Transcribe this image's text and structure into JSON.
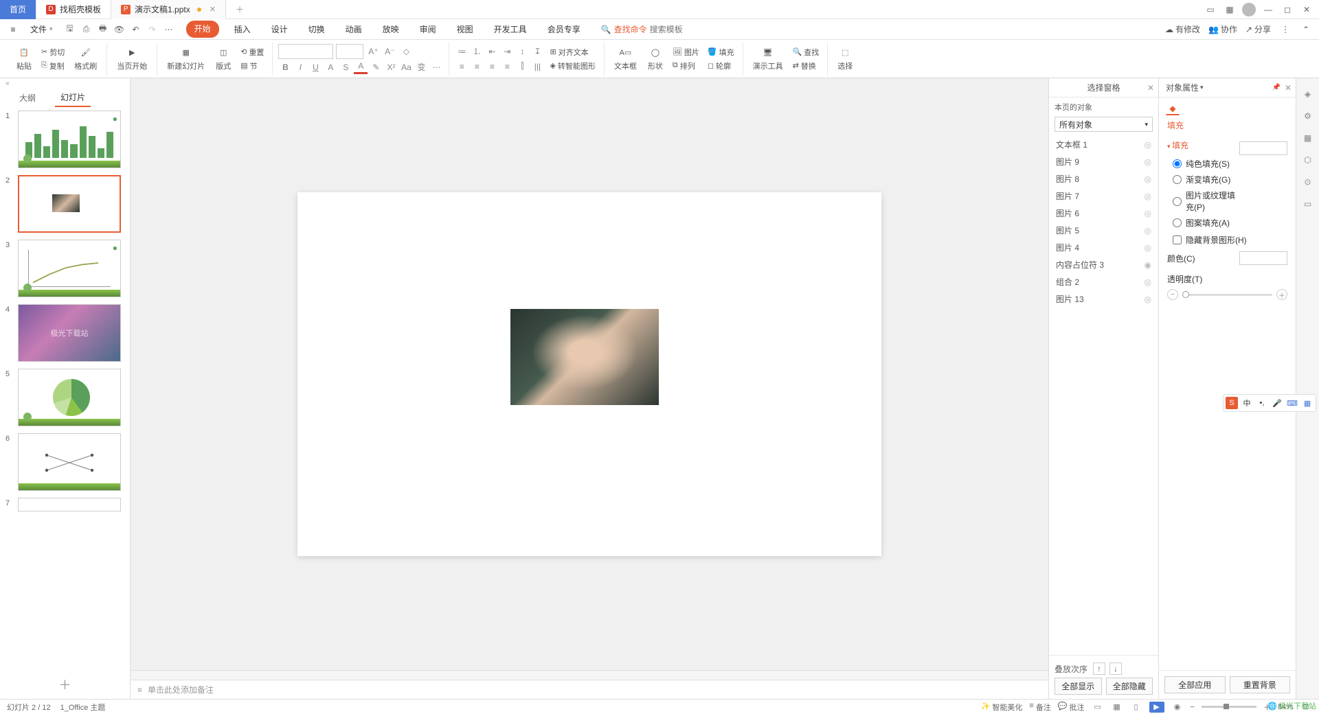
{
  "titlebar": {
    "home": "首页",
    "tab1": "找稻壳模板",
    "tab2": "演示文稿1.pptx"
  },
  "menubar": {
    "file": "文件",
    "tabs": [
      "开始",
      "插入",
      "设计",
      "切换",
      "动画",
      "放映",
      "审阅",
      "视图",
      "开发工具",
      "会员专享"
    ],
    "search_label": "查找命令",
    "search_placeholder": "搜索模板",
    "pending": "有修改",
    "collab": "协作",
    "share": "分享"
  },
  "ribbon": {
    "paste": "粘贴",
    "cut": "剪切",
    "copy": "复制",
    "format_painter": "格式刷",
    "from_begin": "当页开始",
    "new_slide": "新建幻灯片",
    "layout": "版式",
    "reset": "重置",
    "section": "节",
    "align_text": "对齐文本",
    "convert_smart": "转智能图形",
    "textbox": "文本框",
    "shape": "形状",
    "picture": "图片",
    "fill": "填充",
    "arrange": "排列",
    "outline": "轮廓",
    "presenter": "演示工具",
    "find": "查找",
    "replace": "替换",
    "select": "选择"
  },
  "slidepanel": {
    "outline": "大纲",
    "slides": "幻灯片",
    "thumb4_text": "极光下载站"
  },
  "notes": {
    "placeholder": "单击此处添加备注"
  },
  "selection_pane": {
    "title": "选择窗格",
    "subtitle": "本页的对象",
    "all_objects": "所有对象",
    "items": [
      "文本框 1",
      "图片 9",
      "图片 8",
      "图片 7",
      "图片 6",
      "图片 5",
      "图片 4",
      "内容占位符 3",
      "组合 2",
      "图片 13"
    ],
    "order": "叠放次序",
    "show_all": "全部显示",
    "hide_all": "全部隐藏"
  },
  "props": {
    "title": "对象属性",
    "fill_tab": "填充",
    "fill_header": "填充",
    "opts": {
      "solid": "纯色填充(S)",
      "gradient": "渐变填充(G)",
      "picture": "图片或纹理填充(P)",
      "pattern": "图案填充(A)"
    },
    "hide_bg": "隐藏背景图形(H)",
    "color": "颜色(C)",
    "opacity": "透明度(T)",
    "opacity_val": "0%",
    "apply_all": "全部应用",
    "reset_bg": "重置背景"
  },
  "statusbar": {
    "slide_info": "幻灯片 2 / 12",
    "theme": "1_Office 主题",
    "beautify": "智能美化",
    "notes": "备注",
    "comments": "批注",
    "zoom": "84%"
  },
  "ime": {
    "ch": "中",
    "comma": "•,",
    "mic": "🎤",
    "kb": "⌨",
    "grid": "▦"
  },
  "watermark": "极光下载站"
}
